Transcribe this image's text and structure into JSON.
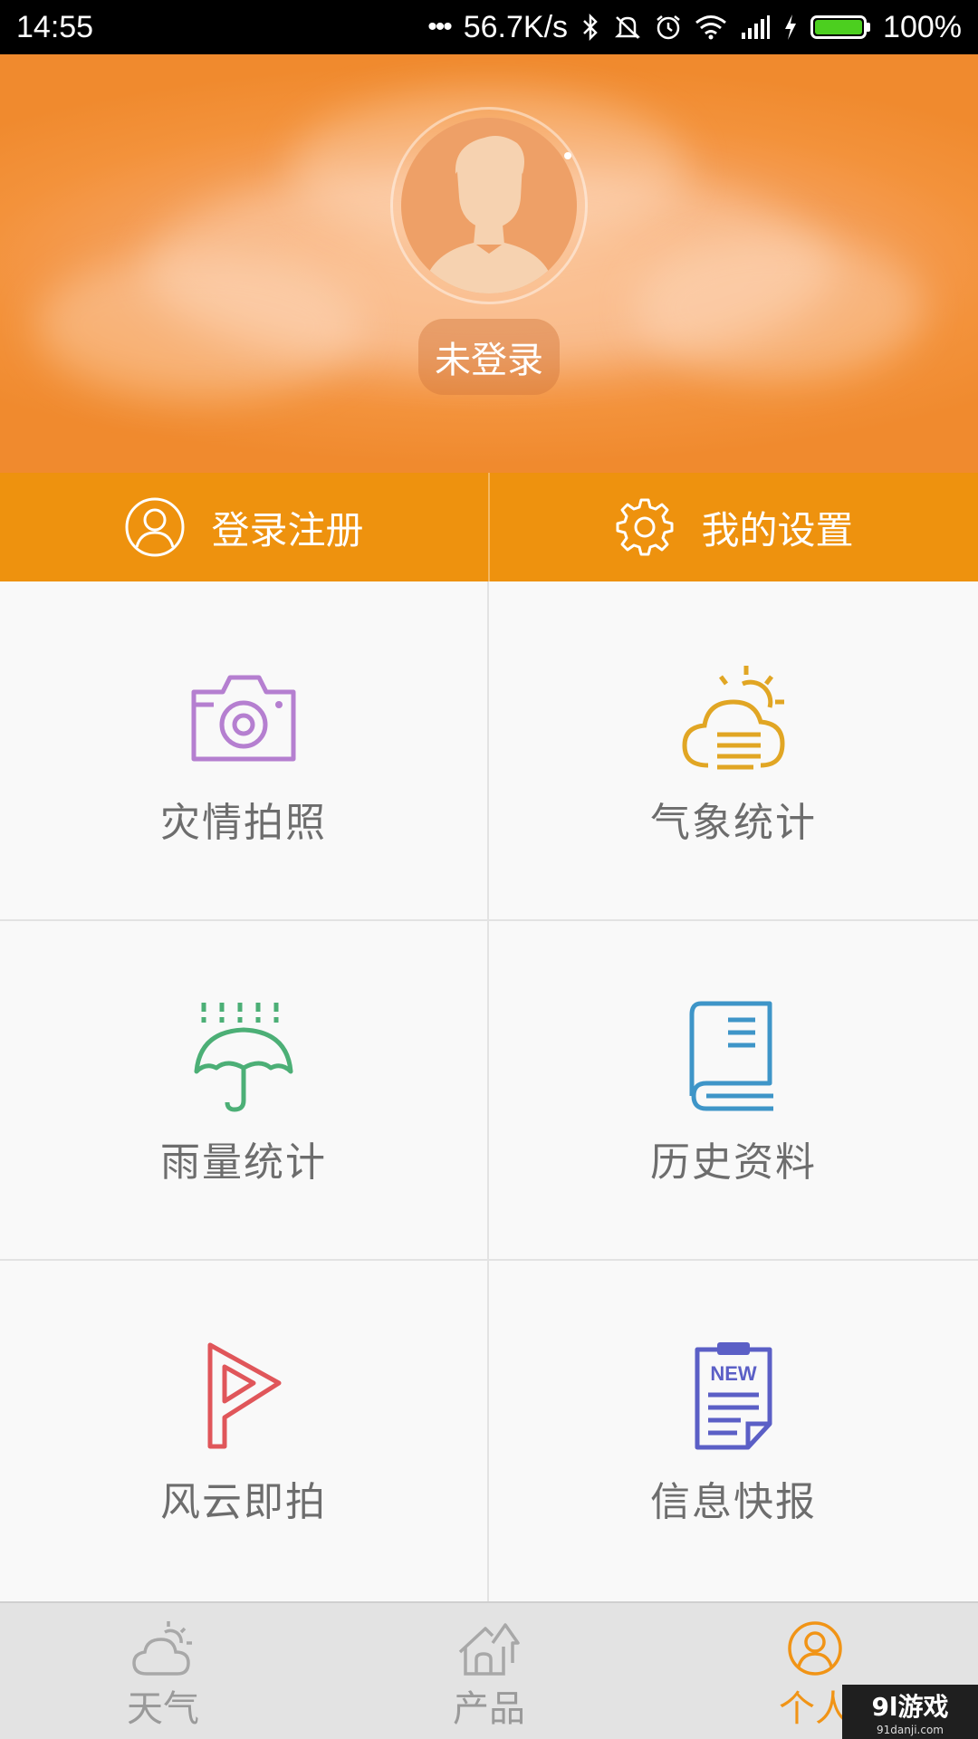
{
  "status_bar": {
    "time": "14:55",
    "dots": "•••",
    "speed": "56.7K/s",
    "battery_percent": "100%",
    "battery_level": 1.0,
    "icons": [
      "bluetooth-icon",
      "mute-icon",
      "alarm-icon",
      "wifi-icon",
      "signal-icon",
      "charging-icon"
    ]
  },
  "profile": {
    "status": "未登录"
  },
  "actions": {
    "login": {
      "label": "登录注册",
      "icon": "user-circle-icon"
    },
    "settings": {
      "label": "我的设置",
      "icon": "gear-icon"
    }
  },
  "menu": {
    "items": [
      {
        "label": "灾情拍照",
        "icon": "camera-icon",
        "color": "#b57fd0"
      },
      {
        "label": "气象统计",
        "icon": "sun-cloud-icon",
        "color": "#e1a624"
      },
      {
        "label": "雨量统计",
        "icon": "umbrella-rain-icon",
        "color": "#4caf76"
      },
      {
        "label": "历史资料",
        "icon": "book-icon",
        "color": "#3e95c8"
      },
      {
        "label": "风云即拍",
        "icon": "play-arrow-icon",
        "color": "#e0565a"
      },
      {
        "label": "信息快报",
        "icon": "news-clipboard-icon",
        "color": "#5b5fc6",
        "badge": "NEW"
      }
    ]
  },
  "bottom_nav": {
    "items": [
      {
        "label": "天气",
        "icon": "weather-icon",
        "active": false
      },
      {
        "label": "产品",
        "icon": "house-icon",
        "active": false
      },
      {
        "label": "个人",
        "icon": "person-icon",
        "active": true
      }
    ]
  },
  "watermark": {
    "title": "9l游戏",
    "url": "91danji.com"
  },
  "colors": {
    "header_orange": "#f3923b",
    "action_orange": "#ee920e",
    "active_tab": "#f19416",
    "label_gray": "#6d6d6d"
  }
}
